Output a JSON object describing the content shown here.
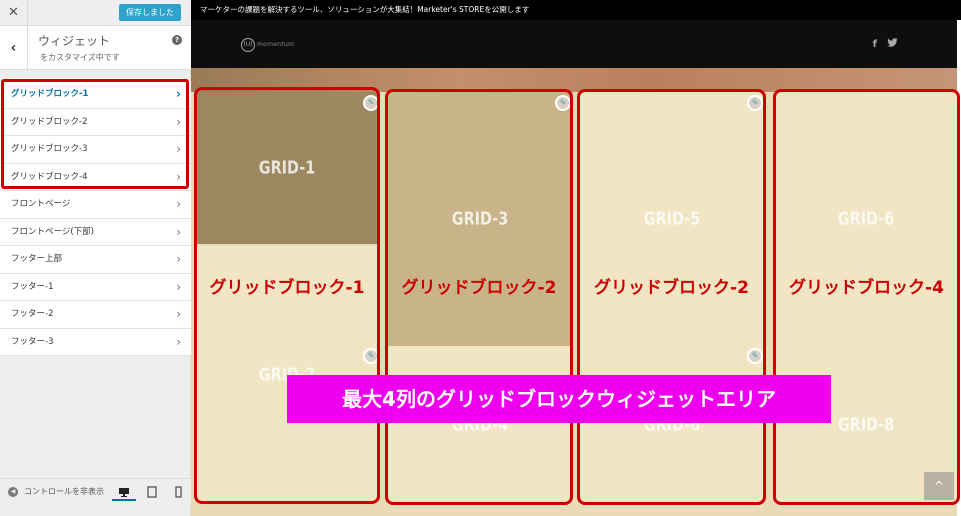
{
  "sidebar": {
    "close_glyph": "✕",
    "save_label": "保存しました",
    "back_glyph": "‹",
    "title": "ウィジェット",
    "subtitle": "をカスタマイズ中です",
    "help_glyph": "?",
    "items": [
      {
        "label": "グリッドブロック-1"
      },
      {
        "label": "グリッドブロック-2"
      },
      {
        "label": "グリッドブロック-3"
      },
      {
        "label": "グリッドブロック-4"
      },
      {
        "label": "フロントページ"
      },
      {
        "label": "フロントページ(下部)"
      },
      {
        "label": "フッター上部"
      },
      {
        "label": "フッター-1"
      },
      {
        "label": "フッター-2"
      },
      {
        "label": "フッター-3"
      }
    ],
    "active_index": 0,
    "chevron": "›",
    "collapse_label": "コントロールを非表示",
    "devices": [
      "desktop-icon",
      "tablet-icon",
      "mobile-icon"
    ]
  },
  "preview": {
    "topbar_text": "マーケターの課題を解決するツール、ソリューションが大集結！Marketer's STOREを公開します",
    "logo_mark": "(U)",
    "logo_text": "momentum",
    "social": {
      "facebook": "f",
      "twitter": "🐦"
    },
    "tiles": [
      {
        "label": "GRID-1"
      },
      {
        "label": "GRID-3"
      },
      {
        "label": "GRID-5"
      },
      {
        "label": "GRID-6"
      },
      {
        "label": "GRID-2"
      },
      {
        "label": "GRID-4"
      },
      {
        "label": "GRID-6"
      },
      {
        "label": "GRID-8"
      }
    ],
    "edit_glyph": "✎",
    "block_labels": [
      "グリッドブロック-1",
      "グリッドブロック-2",
      "グリッドブロック-2",
      "グリッドブロック-4"
    ],
    "banner": "最大4列のグリッドブロックウィジェットエリア",
    "to_top_glyph": "^"
  },
  "colors": {
    "accent": "#0073aa",
    "save_button": "#2ea2cc",
    "annotation_red": "#cc0000",
    "banner_magenta": "#ee00ee"
  }
}
